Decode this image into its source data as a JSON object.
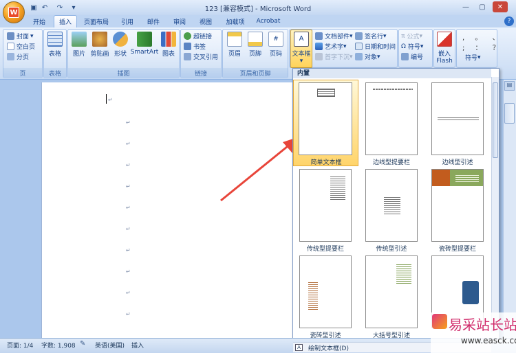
{
  "title": "123 [兼容模式] - Microsoft Word",
  "tabs": [
    "开始",
    "插入",
    "页面布局",
    "引用",
    "邮件",
    "审阅",
    "视图",
    "加载项",
    "Acrobat"
  ],
  "groups": {
    "pages": {
      "label": "页",
      "items": [
        "封面",
        "空白页",
        "分页"
      ]
    },
    "tables": {
      "label": "表格",
      "items": [
        "表格"
      ]
    },
    "illustrations": {
      "label": "插图",
      "items": [
        "图片",
        "剪贴画",
        "形状",
        "SmartArt",
        "图表"
      ]
    },
    "links": {
      "label": "链接",
      "items": [
        "超链接",
        "书签",
        "交叉引用"
      ]
    },
    "header_footer": {
      "label": "页眉和页脚",
      "items": [
        "页眉",
        "页脚",
        "页码"
      ]
    },
    "text": {
      "items": [
        "文本框",
        "文档部件",
        "艺术字",
        "首字下沉",
        "签名行",
        "日期和时间",
        "对象"
      ]
    },
    "symbols": {
      "items": [
        "公式",
        "符号",
        "编号"
      ]
    },
    "flash": {
      "items": [
        "嵌入",
        "Flash"
      ]
    },
    "special": {
      "items": [
        "符号"
      ]
    }
  },
  "dropdown": {
    "header": "内置",
    "items": [
      "简单文本框",
      "边线型提要栏",
      "边线型引述",
      "传统型提要栏",
      "传统型引述",
      "瓷砖型提要栏",
      "瓷砖型引述",
      "大括号型引述",
      ""
    ],
    "footer": "绘制文本框(D)"
  },
  "status": {
    "page": "页面: 1/4",
    "words": "字数: 1,908",
    "lang": "英语(美国)",
    "mode": "插入"
  },
  "watermark": {
    "text": "易采站长站",
    "url": "www.easck.com"
  },
  "colors": {
    "accent": "#15428b",
    "ribbon": "#d3e2f6",
    "arrow": "#e8453a",
    "tile": "#c25c1e"
  }
}
